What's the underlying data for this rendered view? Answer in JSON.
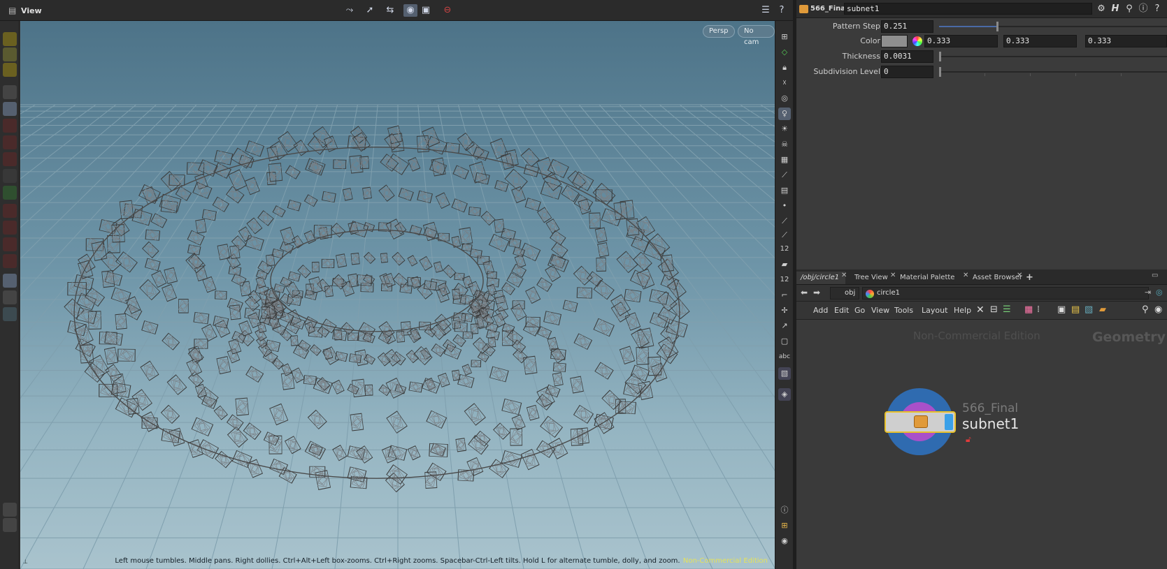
{
  "viewer": {
    "title": "View",
    "camera_menu": "Persp",
    "cam_menu": "No cam",
    "status_hint": "Left mouse tumbles. Middle pans. Right dollies. Ctrl+Alt+Left box-zooms. Ctrl+Right zooms. Spacebar-Ctrl-Left tilts. Hold L for alternate tumble, dolly, and zoom.",
    "edition_badge": "Non-Commercial Edition",
    "top_tools": [
      "tumble-tool-icon",
      "select-tool-icon",
      "transform-tool-icon",
      "display-mode-icon",
      "snapshot-icon",
      "stop-icon"
    ],
    "right_tools_text": {
      "label_12_a": "12",
      "label_12_b": "12",
      "abc": "abc"
    }
  },
  "parameters": {
    "node_type_label": "566_Final",
    "node_name": "subnet1",
    "params": [
      {
        "label": "Pattern Step",
        "value": "0.251",
        "fraction": 0.251
      },
      {
        "label": "Color",
        "r": "0.333",
        "g": "0.333",
        "b": "0.333",
        "swatch": "#8f8f8f"
      },
      {
        "label": "Thickness",
        "value": "0.0031",
        "fraction": 0.0031
      },
      {
        "label": "Subdivision Level",
        "value": "0",
        "fraction": 0
      }
    ]
  },
  "network": {
    "tabs": [
      {
        "label": "/obj/circle1"
      },
      {
        "label": "Tree View"
      },
      {
        "label": "Material Palette"
      },
      {
        "label": "Asset Browser"
      }
    ],
    "add_tab_label": "+",
    "path": {
      "root": "obj",
      "current": "circle1"
    },
    "menu": [
      "Add",
      "Edit",
      "Go",
      "View",
      "Tools",
      "Layout",
      "Help"
    ],
    "watermark": "Non-Commercial Edition",
    "context_label": "Geometry",
    "node": {
      "type": "566_Final",
      "name": "subnet1"
    }
  },
  "colors": {
    "accent_blue": "#2f6bb0",
    "node_purple": "#a950c9",
    "selection_yellow": "#e8c12a",
    "nce_yellow": "#e6e35a"
  }
}
